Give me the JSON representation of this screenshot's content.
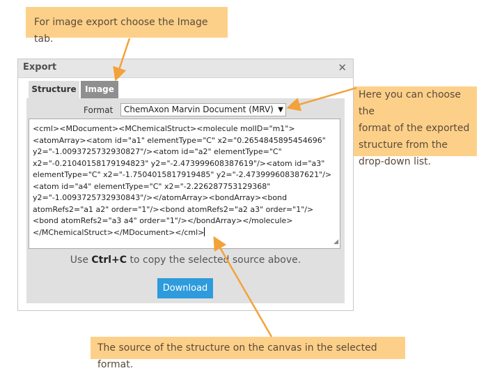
{
  "callouts": {
    "top": "For image export choose the Image tab.",
    "right": [
      "Here you can choose the",
      "format of the exported",
      "structure from the",
      "drop-down list."
    ],
    "bottom": "The source of the structure on the canvas in the selected format."
  },
  "dialog": {
    "title": "Export",
    "close_glyph": "✕",
    "tabs": [
      {
        "label": "Structure",
        "active": true
      },
      {
        "label": "Image",
        "active": false
      }
    ],
    "format_label": "Format",
    "format_value": "ChemAxon Marvin Document (MRV)",
    "format_arrow": "▼",
    "source_lines": [
      "<cml><MDocument><MChemicalStruct><molecule molID=\"m1\">",
      "<atomArray><atom id=\"a1\" elementType=\"C\" x2=\"0.2654845895454696\"",
      "y2=\"-1.0093725732930827\"/><atom id=\"a2\" elementType=\"C\"",
      "x2=\"-0.21040158179194823\" y2=\"-2.473999608387619\"/><atom id=\"a3\"",
      "elementType=\"C\" x2=\"-1.7504015817919485\" y2=\"-2.473999608387621\"/>",
      "<atom id=\"a4\" elementType=\"C\" x2=\"-2.226287753129368\"",
      "y2=\"-1.0093725732930843\"/></atomArray><bondArray><bond",
      "atomRefs2=\"a1 a2\" order=\"1\"/><bond atomRefs2=\"a2 a3\" order=\"1\"/>",
      "<bond atomRefs2=\"a3 a4\" order=\"1\"/></bondArray></molecule>",
      "</MChemicalStruct></MDocument></cml>"
    ],
    "copy_hint_pre": "Use ",
    "copy_hint_key": "Ctrl+C",
    "copy_hint_post": " to copy the selected source above.",
    "download_label": "Download"
  },
  "colors": {
    "callout_bg": "#fdd089",
    "arrow": "#f3a23a",
    "download_bg": "#2e9bdc",
    "image_tab_bg": "#8f8f8f"
  }
}
